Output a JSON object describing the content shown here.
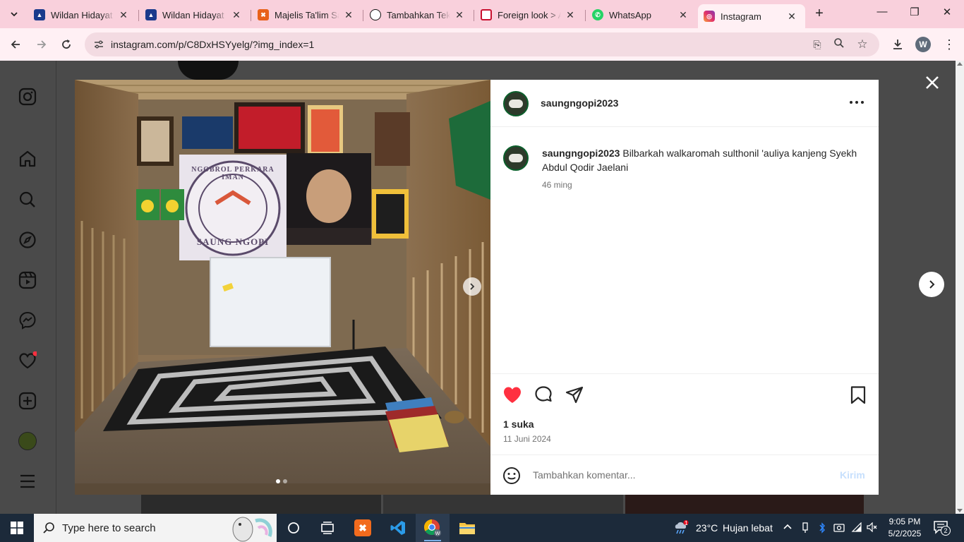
{
  "browser": {
    "tabs": [
      {
        "title": "Wildan Hidayat -",
        "icon": "avatar-favicon",
        "color": "#1a3a8c"
      },
      {
        "title": "Wildan Hidayat",
        "icon": "avatar-favicon",
        "color": "#1a3a8c"
      },
      {
        "title": "Majelis Ta'lim Sa",
        "icon": "xampp-icon",
        "color": "#e8611a"
      },
      {
        "title": "Tambahkan Teks",
        "icon": "chatgpt-icon",
        "color": "#111111"
      },
      {
        "title": "Foreign look > A",
        "icon": "red-flag-icon",
        "color": "#c8102e"
      },
      {
        "title": "WhatsApp",
        "icon": "whatsapp-icon",
        "color": "#25d366"
      },
      {
        "title": "Instagram",
        "icon": "instagram-icon",
        "color": "#e1306c"
      }
    ],
    "active_tab_index": 6,
    "url": "instagram.com/p/C8DxHSYyelg/?img_index=1",
    "profile_initial": "W"
  },
  "post": {
    "username": "saungngopi2023",
    "caption": "Bilbarkah walkaromah sulthonil 'auliya kanjeng Syekh Abdul Qodir Jaelani",
    "caption_time": "46 ming",
    "likes": "1 suka",
    "date": "11 Juni 2024",
    "comment_placeholder": "Tambahkan komentar...",
    "send_label": "Kirim",
    "liked": true,
    "image_count": 2,
    "current_image": 1
  },
  "image": {
    "banner_top": "NGOBROL PERKARA IMAN",
    "banner_bottom": "SAUNG NGOPI"
  },
  "taskbar": {
    "search_placeholder": "Type here to search",
    "weather_temp": "23°C",
    "weather_desc": "Hujan lebat",
    "weather_badge": "1",
    "time": "9:05 PM",
    "date": "5/2/2025",
    "notification_count": "2"
  },
  "colors": {
    "chrome_tab_strip": "#f9d0dc",
    "chrome_toolbar": "#fff0f4",
    "like_red": "#ff3040",
    "send_disabled": "#c7e0fd"
  }
}
